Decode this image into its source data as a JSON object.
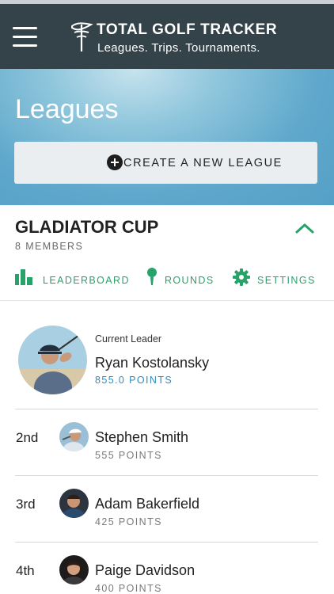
{
  "app": {
    "title": "Total Golf Tracker",
    "title_display": "TOTAL GOLF TRACKER",
    "tagline": "Leagues. Trips. Tournaments."
  },
  "icons": {
    "menu": "menu-icon",
    "logo": "golf-flag-logo-icon",
    "create": "plus-circle-icon",
    "collapse": "chevron-up-icon",
    "leaderboard": "bar-chart-icon",
    "rounds": "golf-tee-icon",
    "settings": "gear-icon"
  },
  "colors": {
    "header_bg": "#34434a",
    "accent_green": "#27a36a",
    "points_blue": "#2a8ec0"
  },
  "hero": {
    "title": "Leagues",
    "create_label": "CREATE A NEW LEAGUE"
  },
  "league": {
    "name": "GLADIATOR CUP",
    "members": "8 MEMBERS",
    "tabs": {
      "leaderboard": "LEADERBOARD",
      "rounds": "ROUNDS",
      "settings": "SETTINGS"
    }
  },
  "leader": {
    "caption": "Current Leader",
    "name": "Ryan Kostolansky",
    "points": "855.0 POINTS"
  },
  "standings": [
    {
      "rank": "2nd",
      "name": "Stephen Smith",
      "points": "555 POINTS"
    },
    {
      "rank": "3rd",
      "name": "Adam Bakerfield",
      "points": "425 POINTS"
    },
    {
      "rank": "4th",
      "name": "Paige Davidson",
      "points": "400 POINTS"
    }
  ]
}
